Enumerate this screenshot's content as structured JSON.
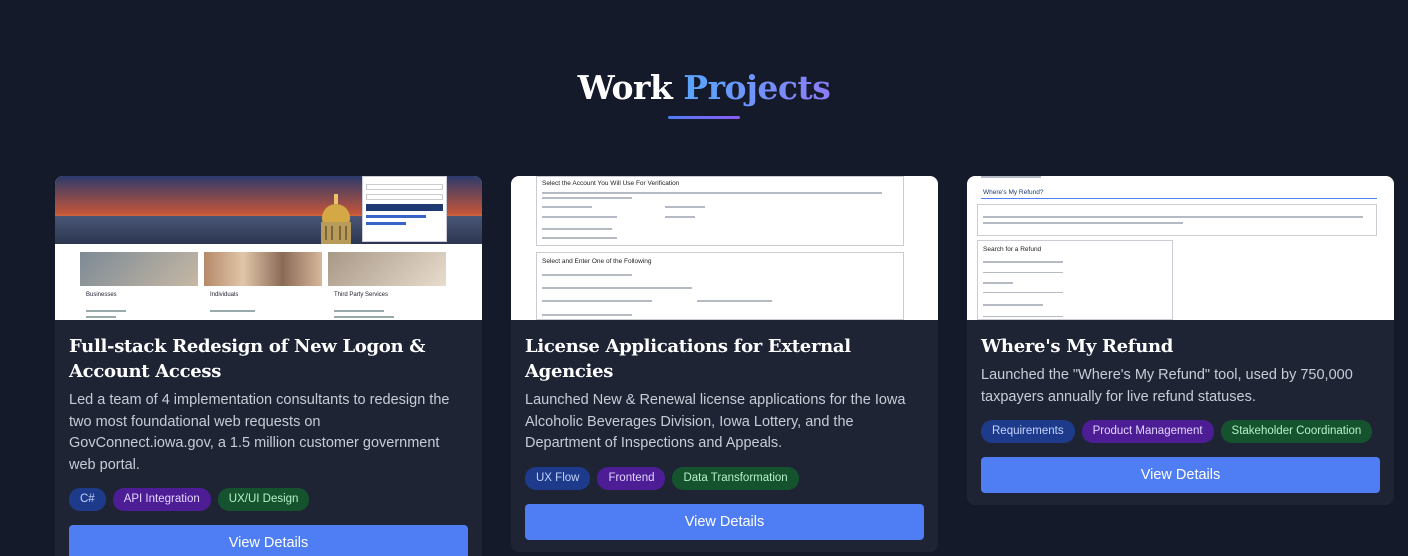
{
  "section": {
    "title_part1": "Work",
    "title_part2": "Projects"
  },
  "projects": [
    {
      "title": "Full-stack Redesign of New Logon & Account Access",
      "description": "Led a team of 4 implementation consultants to redesign the two most foundational web requests on GovConnect.iowa.gov, a 1.5 million customer government web portal.",
      "tags": [
        {
          "label": "C#",
          "color": "#1e3a8a"
        },
        {
          "label": "API Integration",
          "color": "#4c1d95"
        },
        {
          "label": "UX/UI Design",
          "color": "#14532d"
        }
      ],
      "button_label": "View Details",
      "thumb": {
        "columns": [
          "Businesses",
          "Individuals",
          "Third Party Services"
        ]
      }
    },
    {
      "title": "License Applications for External Agencies",
      "description": "Launched New & Renewal license applications for the Iowa Alcoholic Beverages Division, Iowa Lottery, and the Department of Inspections and Appeals.",
      "tags": [
        {
          "label": "UX Flow",
          "color": "#1e3a8a"
        },
        {
          "label": "Frontend",
          "color": "#4c1d95"
        },
        {
          "label": "Data Transformation",
          "color": "#14532d"
        }
      ],
      "button_label": "View Details",
      "thumb": {
        "heading1": "Select the Account You Will Use For Verification",
        "heading2": "Select and Enter One of the Following"
      }
    },
    {
      "title": "Where's My Refund",
      "description": "Launched the \"Where's My Refund\" tool, used by 750,000 taxpayers annually for live refund statuses.",
      "tags": [
        {
          "label": "Requirements",
          "color": "#1e3a8a"
        },
        {
          "label": "Product Management",
          "color": "#4c1d95"
        },
        {
          "label": "Stakeholder Coordination",
          "color": "#14532d"
        }
      ],
      "button_label": "View Details",
      "thumb": {
        "heading1": "Where's My Refund?",
        "heading2": "Search for a Refund"
      }
    }
  ]
}
